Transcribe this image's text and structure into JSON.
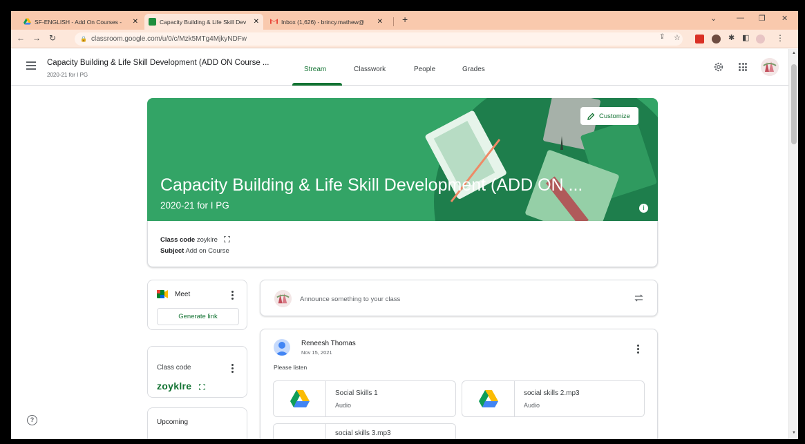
{
  "browser": {
    "tabs": [
      {
        "title": "SF-ENGLISH - Add On Courses - ",
        "icon": "google-drive-icon"
      },
      {
        "title": "Capacity Building & Life Skill Dev",
        "icon": "google-classroom-icon"
      },
      {
        "title": "Inbox (1,626) - brincy.mathew@",
        "icon": "gmail-icon"
      }
    ],
    "new_tab": "+",
    "url": "classroom.google.com/u/0/c/Mzk5MTg4MjkyNDFw"
  },
  "header": {
    "class_title": "Capacity Building & Life Skill Development (ADD ON Course ...",
    "class_subtitle": "2020-21 for I PG",
    "tabs": [
      {
        "label": "Stream"
      },
      {
        "label": "Classwork"
      },
      {
        "label": "People"
      },
      {
        "label": "Grades"
      }
    ]
  },
  "banner": {
    "title": "Capacity Building & Life Skill Development (ADD ON ...",
    "subtitle": "2020-21 for I PG",
    "customize_label": "Customize",
    "color": "#33a466"
  },
  "class_info": {
    "code_label": "Class code",
    "code": "zoyklre",
    "subject_label": "Subject",
    "subject": "Add on Course"
  },
  "meet": {
    "label": "Meet",
    "generate_label": "Generate link"
  },
  "code_card": {
    "label": "Class code",
    "code": "zoyklre"
  },
  "upcoming": {
    "label": "Upcoming"
  },
  "announce": {
    "placeholder": "Announce something to your class"
  },
  "post": {
    "author": "Reneesh Thomas",
    "date": "Nov 15, 2021",
    "text": "Please listen",
    "attachments": [
      {
        "name": "Social Skills 1",
        "type": "Audio"
      },
      {
        "name": "social skills 2.mp3",
        "type": "Audio"
      },
      {
        "name": "social skills 3.mp3",
        "type": ""
      }
    ]
  },
  "colors": {
    "accent": "#137333",
    "tabstrip": "#f9c9ad"
  }
}
